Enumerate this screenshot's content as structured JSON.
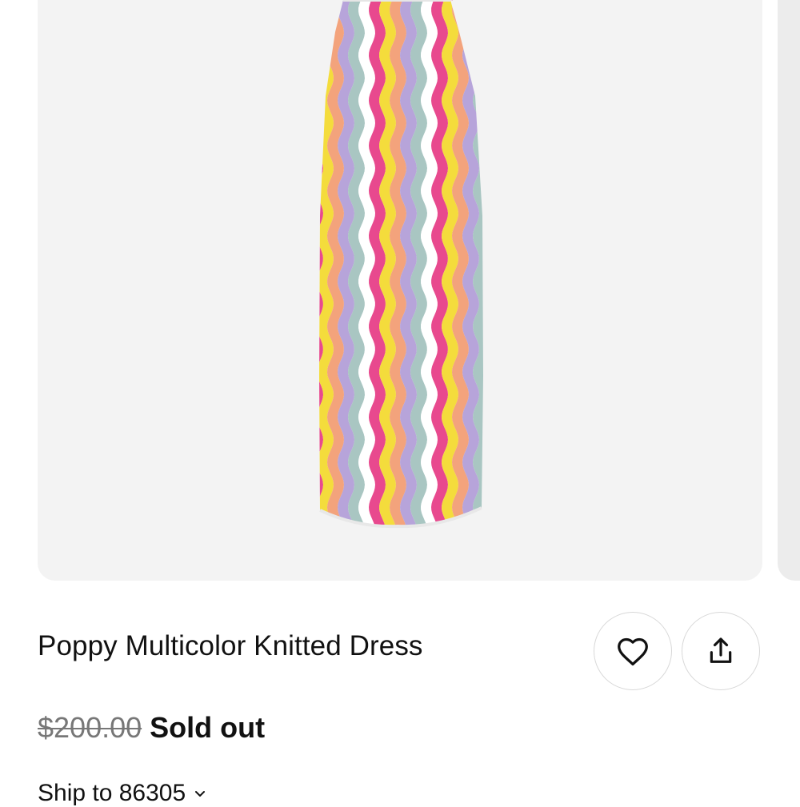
{
  "product": {
    "title": "Poppy Multicolor Knitted Dress",
    "original_price": "$200.00",
    "status": "Sold out"
  },
  "actions": {
    "favorite_icon": "heart-icon",
    "share_icon": "share-icon"
  },
  "shipping": {
    "label": "Ship to 86305",
    "icon": "chevron-down-icon"
  },
  "colors": {
    "stripe_colors": [
      "#e8498e",
      "#f4dc3c",
      "#f3a37c",
      "#b7a4da",
      "#a9c6c2",
      "#ffffff"
    ],
    "gallery_bg": "#f3f3f3"
  }
}
